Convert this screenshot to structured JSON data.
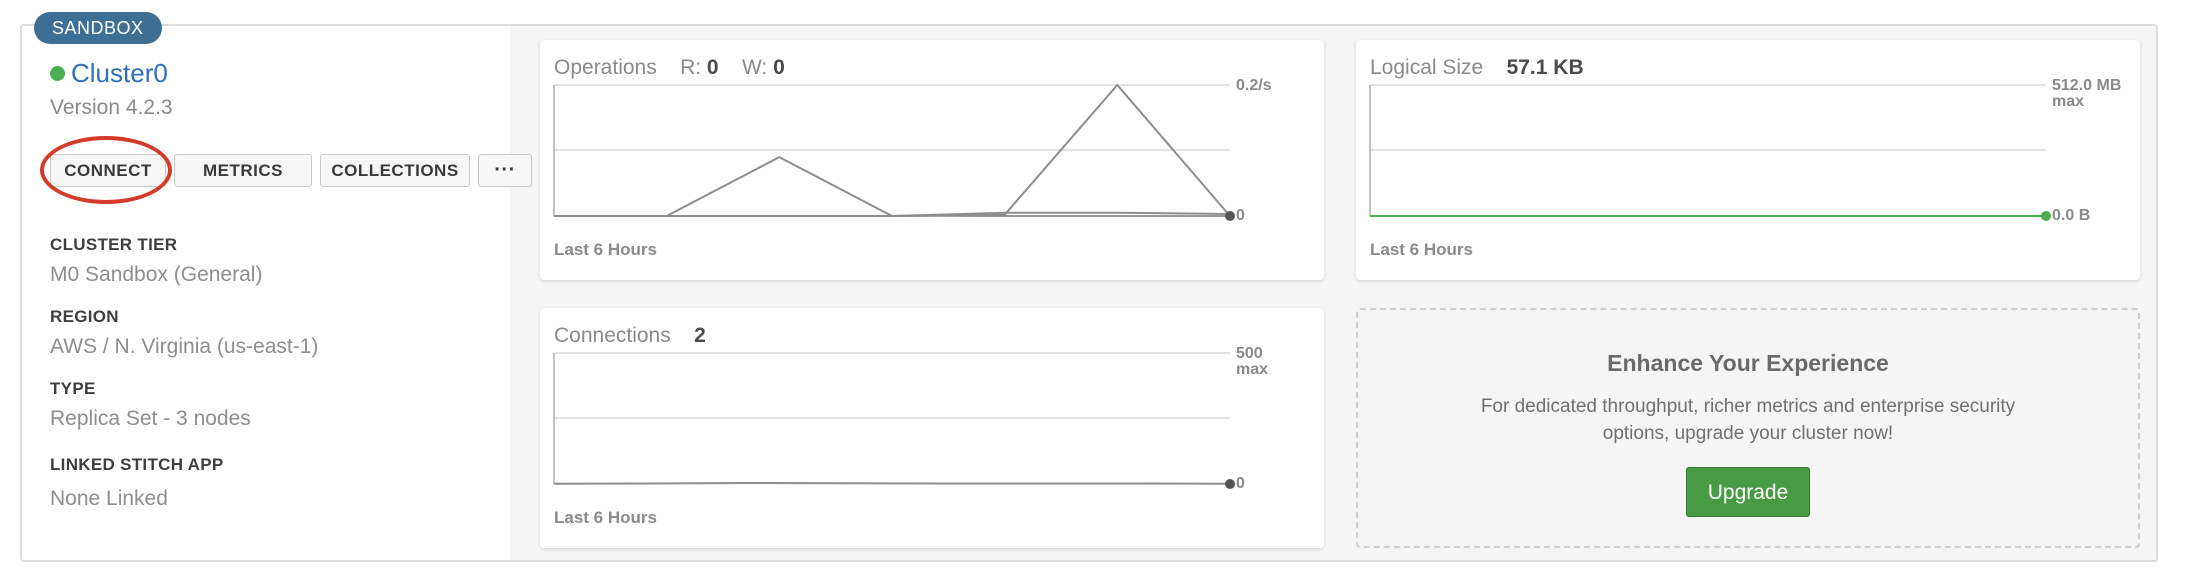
{
  "badge": "SANDBOX",
  "cluster": {
    "name": "Cluster0",
    "version": "Version 4.2.3",
    "status_color": "#4caf50"
  },
  "buttons": {
    "connect": "CONNECT",
    "metrics": "METRICS",
    "collections": "COLLECTIONS",
    "more": "···"
  },
  "info": [
    {
      "label": "CLUSTER TIER",
      "value": "M0 Sandbox (General)"
    },
    {
      "label": "REGION",
      "value": "AWS / N. Virginia (us-east-1)"
    },
    {
      "label": "TYPE",
      "value": "Replica Set - 3 nodes"
    },
    {
      "label": "LINKED STITCH APP",
      "value": "None Linked"
    }
  ],
  "operations": {
    "title": "Operations",
    "r_label": "R:",
    "r_value": "0",
    "w_label": "W:",
    "w_value": "0",
    "max_label": "0.2/s",
    "min_label": "0",
    "footer": "Last 6 Hours",
    "series_a": [
      0,
      0,
      0.09,
      0,
      0.002,
      0.2,
      0
    ],
    "series_b": [
      0,
      0,
      0,
      0,
      0.005,
      0.005,
      0.003
    ],
    "ymax": 0.2
  },
  "connections": {
    "title": "Connections",
    "value": "2",
    "max_label": "500",
    "max_sub": "max",
    "min_label": "0",
    "footer": "Last 6 Hours",
    "series": [
      1,
      2,
      4,
      3,
      2,
      2,
      2,
      1
    ],
    "ymax": 500
  },
  "logical_size": {
    "title": "Logical Size",
    "value": "57.1 KB",
    "max_label": "512.0 MB",
    "max_sub": "max",
    "min_label": "0.0 B",
    "footer": "Last 6 Hours",
    "line_color": "#4caf50"
  },
  "upsell": {
    "heading": "Enhance Your Experience",
    "text": "For dedicated throughput, richer metrics and enterprise security options, upgrade your cluster now!",
    "button": "Upgrade"
  },
  "colors": {
    "badge": "#3d6f95",
    "link": "#2f6fbc",
    "highlight_ring": "#d63a2b",
    "upgrade_button": "#469b43"
  }
}
